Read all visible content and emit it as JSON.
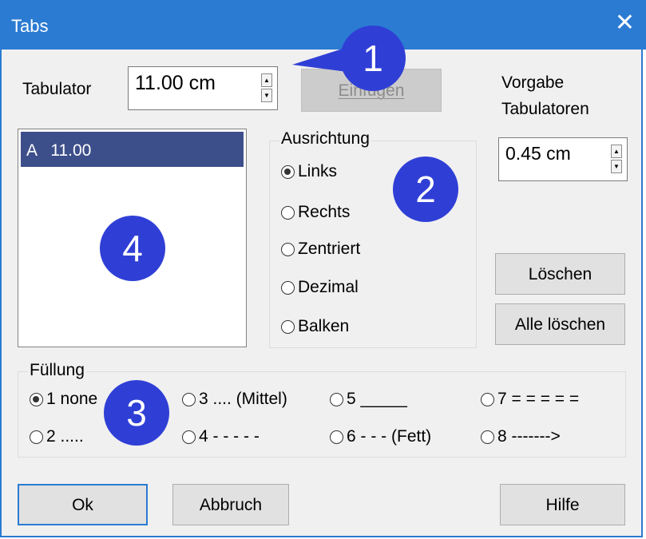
{
  "window": {
    "title": "Tabs",
    "close_glyph": "✕"
  },
  "tabulator": {
    "label": "Tabulator",
    "value": "11.00 cm"
  },
  "insert_button": {
    "label": "Einfügen"
  },
  "default_tabs": {
    "label_line1": "Vorgabe",
    "label_line2": "Tabulatoren",
    "value": "0.45 cm"
  },
  "tab_list": {
    "items": [
      {
        "label": "A   11.00"
      }
    ]
  },
  "alignment": {
    "title": "Ausrichtung",
    "options": [
      {
        "label": "Links",
        "selected": true
      },
      {
        "label": "Rechts",
        "selected": false
      },
      {
        "label": "Zentriert",
        "selected": false
      },
      {
        "label": "Dezimal",
        "selected": false
      },
      {
        "label": "Balken",
        "selected": false
      }
    ]
  },
  "delete_button": {
    "label": "Löschen"
  },
  "delete_all_button": {
    "label": "Alle löschen"
  },
  "fill": {
    "title": "Füllung",
    "options": [
      {
        "label": "1 none",
        "selected": true
      },
      {
        "label": "2 .....",
        "selected": false
      },
      {
        "label": "3 .... (Mittel)",
        "selected": false
      },
      {
        "label": "4 - - - - -",
        "selected": false
      },
      {
        "label": "5 _____",
        "selected": false
      },
      {
        "label": "6 - - - (Fett)",
        "selected": false
      },
      {
        "label": "7 = = = = =",
        "selected": false
      },
      {
        "label": "8 ------->",
        "selected": false
      }
    ]
  },
  "footer": {
    "ok_label": "Ok",
    "cancel_label": "Abbruch",
    "help_label": "Hilfe"
  },
  "badges": {
    "b1": "1",
    "b2": "2",
    "b3": "3",
    "b4": "4"
  },
  "colors": {
    "titlebar": "#2b7bd3",
    "badge": "#2f3fd6",
    "selection": "#3d4f8a"
  }
}
